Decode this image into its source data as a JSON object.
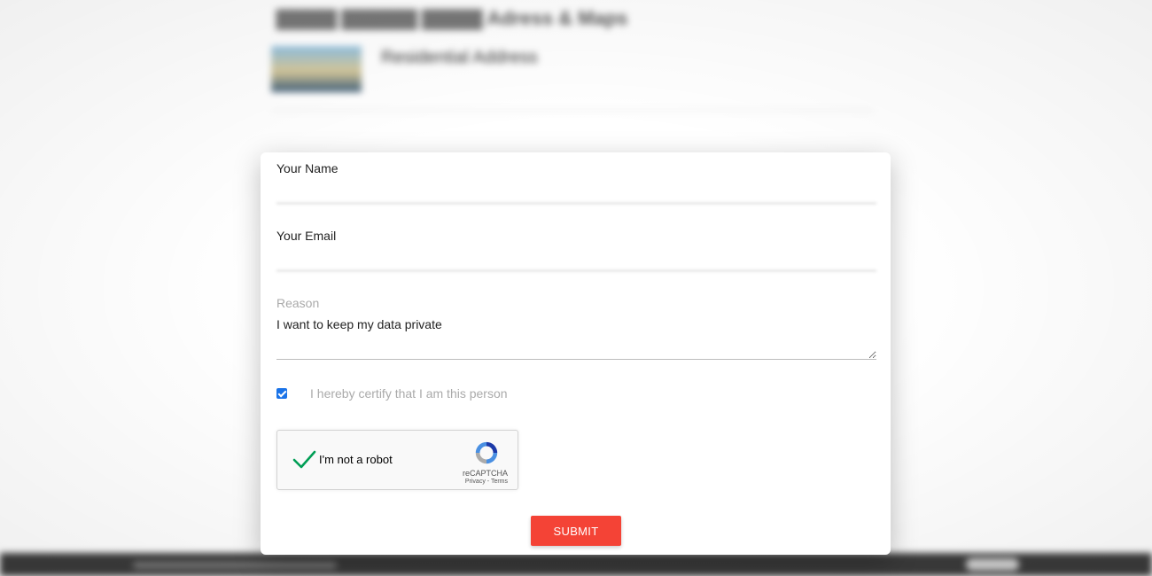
{
  "background": {
    "title_suffix": "Adress & Maps",
    "record_title": "Residential Address",
    "record_address": "",
    "notice": ""
  },
  "form": {
    "name_label": "Your Name",
    "name_value": "",
    "email_label": "Your Email",
    "email_value": "",
    "reason_label": "Reason",
    "reason_value": "I want to keep my data private",
    "certify_label": "I hereby certify that I am this person",
    "certify_checked": true
  },
  "captcha": {
    "label": "I'm not a robot",
    "brand": "reCAPTCHA",
    "privacy": "Privacy",
    "separator": " - ",
    "terms": "Terms",
    "checked": true
  },
  "submit_label": "SUBMIT",
  "colors": {
    "submit": "#f44336",
    "checkbox": "#1a73e8",
    "captcha_check": "#009e55",
    "address_green": "#2e8b57"
  }
}
